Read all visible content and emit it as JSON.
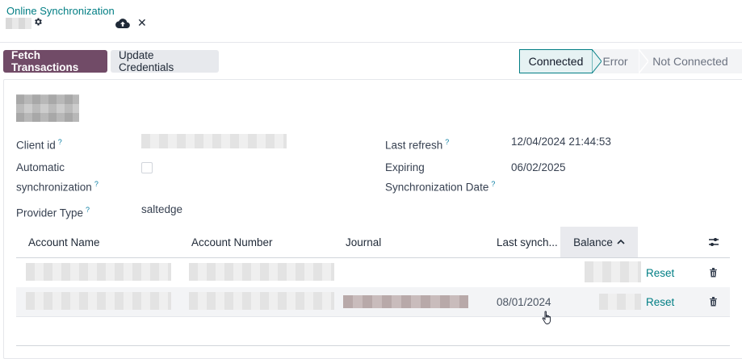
{
  "control_panel": {
    "breadcrumb": "Online Synchronization",
    "gear_icon": "gear-icon",
    "save_icon": "cloud-upload-icon",
    "discard_icon": "close-icon"
  },
  "actions": {
    "fetch_transactions": "Fetch Transactions",
    "update_credentials": "Update Credentials"
  },
  "status_bar": {
    "stages": [
      "Connected",
      "Error",
      "Not Connected"
    ],
    "active": "Connected",
    "accent": "#017e84"
  },
  "form": {
    "client_id_label": "Client id",
    "auto_sync_label_1": "Automatic",
    "auto_sync_label_2": "synchronization",
    "provider_type_label": "Provider Type",
    "provider_type_value": "saltedge",
    "last_refresh_label": "Last refresh",
    "last_refresh_value": "12/04/2024 21:44:53",
    "expiring_label_1": "Expiring",
    "expiring_label_2": "Synchronization Date",
    "expiring_value": "06/02/2025",
    "help_mark": "?"
  },
  "table": {
    "columns": [
      "Account Name",
      "Account Number",
      "Journal",
      "Last synch...",
      "Balance"
    ],
    "sort_indicator": "^",
    "optional_columns_icon": "sliders-icon",
    "rows": [
      {
        "last_sync": "",
        "action": "Reset",
        "delete_icon": "trash-icon"
      },
      {
        "last_sync": "08/01/2024",
        "action": "Reset",
        "delete_icon": "trash-icon"
      }
    ]
  },
  "colors": {
    "primary": "#714b67",
    "link": "#017e84"
  }
}
